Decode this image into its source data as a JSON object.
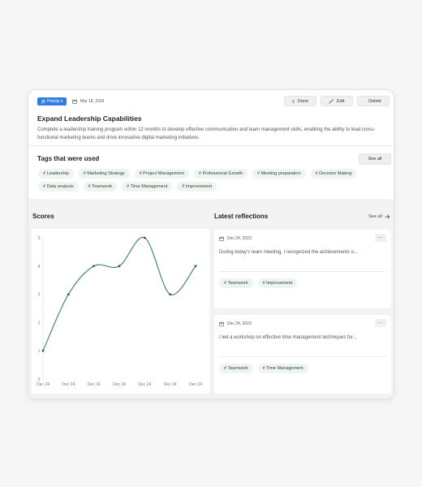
{
  "header": {
    "priority_label": "Priority Ⅱ",
    "date": "Mar 18, 2024",
    "actions": {
      "done": "Done",
      "edit": "Edit",
      "delete": "Delete"
    },
    "title": "Expand Leadership Capabilities",
    "description": "Complete a leadership training program within 12 months to develop effective communication and team management skills, enabling the ability to lead cross-functional marketing teams and drive innovative digital marketing initiatives."
  },
  "tags_section": {
    "title": "Tags that were used",
    "see_all": "See all",
    "tags": [
      "# Leadership",
      "# Marketing Strategy",
      "# Project Management",
      "# Professional Growth",
      "# Meeting preparation",
      "# Decision Making",
      "# Data analysis",
      "# Teamwork",
      "# Time Management",
      "# Improvement"
    ]
  },
  "scores": {
    "title": "Scores"
  },
  "chart_data": {
    "type": "line",
    "categories": [
      "Dec 24",
      "Dec 24",
      "Dec 24",
      "Dec 24",
      "Dec 24",
      "Dec 24",
      "Dec 24"
    ],
    "values": [
      1,
      3,
      4,
      4,
      5,
      3,
      4
    ],
    "ylim": [
      0,
      5
    ],
    "yticks": [
      "0",
      "1",
      "2",
      "3",
      "4",
      "5"
    ],
    "title": "",
    "xlabel": "",
    "ylabel": "",
    "line_color": "#4a8a6a"
  },
  "reflections": {
    "title": "Latest reflections",
    "see_all": "See all",
    "items": [
      {
        "date": "Dec 24, 2023",
        "more": "···",
        "text": "During today's team meeting, I recognized the achievements o...",
        "tags": [
          "# Teamwork",
          "# Improvement"
        ]
      },
      {
        "date": "Dec 24, 2023",
        "more": "···",
        "text": "I led a workshop on effective time management techniques for...",
        "tags": [
          "# Teamwork",
          "# Time Management"
        ]
      }
    ]
  },
  "colors": {
    "priority": "#2f7de0",
    "tag_bg": "#ecf5ef",
    "accent_line": "#4a8a6a"
  },
  "icons": {
    "priority": "flag-icon",
    "date": "calendar-icon",
    "done": "hourglass-icon",
    "edit": "pencil-icon",
    "delete": "trash-icon",
    "see_all": "arrow-right-icon"
  }
}
